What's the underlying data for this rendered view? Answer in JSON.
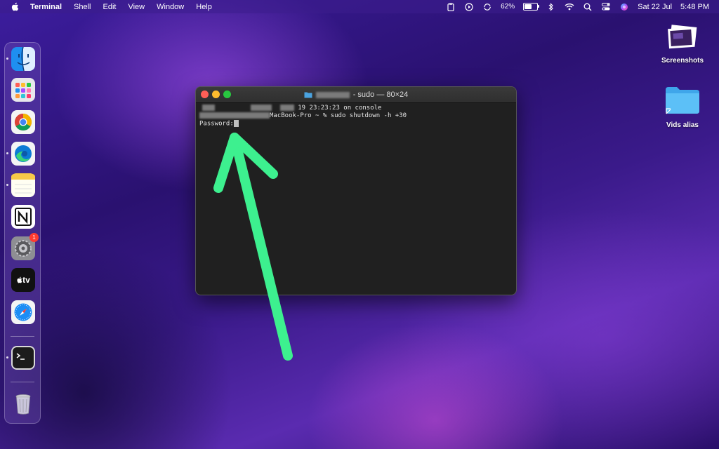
{
  "menubar": {
    "active_app": "Terminal",
    "menus": [
      "Shell",
      "Edit",
      "View",
      "Window",
      "Help"
    ],
    "battery_percent": "62%",
    "date": "Sat 22 Jul",
    "time": "5:48 PM"
  },
  "dock": {
    "apps": [
      "Finder",
      "Launchpad",
      "Google Chrome",
      "Microsoft Edge",
      "Notes",
      "Notion",
      "System Settings",
      "Apple TV",
      "Safari",
      "Terminal",
      "Trash"
    ],
    "settings_badge": "1",
    "appletv_label": "tv"
  },
  "desktop": {
    "icons": [
      {
        "label": "Screenshots"
      },
      {
        "label": "Vids alias"
      }
    ]
  },
  "terminal": {
    "title": "- sudo — 80×24",
    "lines": [
      {
        "prefix": "",
        "text": "19 23:23:23 on console"
      },
      {
        "prefix": "",
        "text": "MacBook-Pro ~ % sudo shutdown -h +30"
      },
      {
        "prefix": "Password:",
        "text": ""
      }
    ]
  },
  "colors": {
    "annotation_arrow": "#3df08f",
    "close": "#ff5f57",
    "minimize": "#febc2e",
    "zoom": "#28c840"
  }
}
